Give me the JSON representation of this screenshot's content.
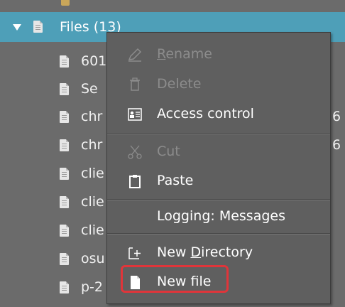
{
  "tree": {
    "selected_node": {
      "label": "Files (13)"
    },
    "children": [
      {
        "label_visible": "601"
      },
      {
        "label_visible": "Se"
      },
      {
        "label_visible": "chr",
        "right_text": "6"
      },
      {
        "label_visible": "chr",
        "right_text": "6"
      },
      {
        "label_visible": "clie"
      },
      {
        "label_visible": "clie"
      },
      {
        "label_visible": "clie"
      },
      {
        "label_visible": "osu"
      },
      {
        "label_visible": "p-2"
      }
    ]
  },
  "context_menu": {
    "items": [
      {
        "label_pre": "",
        "label_u": "R",
        "label_post": "ename",
        "icon": "pencil-icon",
        "enabled": false
      },
      {
        "label_pre": "Delete",
        "label_u": "",
        "label_post": "",
        "icon": "trash-icon",
        "enabled": false
      },
      {
        "label_pre": "Access control",
        "label_u": "",
        "label_post": "",
        "icon": "access-control-icon",
        "enabled": true
      },
      {
        "label_pre": "Cut",
        "label_u": "",
        "label_post": "",
        "icon": "scissors-icon",
        "enabled": false
      },
      {
        "label_pre": "Paste",
        "label_u": "",
        "label_post": "",
        "icon": "clipboard-icon",
        "enabled": true
      },
      {
        "label_pre": "Logging: Messages",
        "label_u": "",
        "label_post": "",
        "icon": "",
        "enabled": true
      },
      {
        "label_pre": "New ",
        "label_u": "D",
        "label_post": "irectory",
        "icon": "new-folder-icon",
        "enabled": true
      },
      {
        "label_pre": "New file",
        "label_u": "",
        "label_post": "",
        "icon": "new-file-icon",
        "enabled": true
      }
    ],
    "highlight_color": "#e0353a"
  }
}
